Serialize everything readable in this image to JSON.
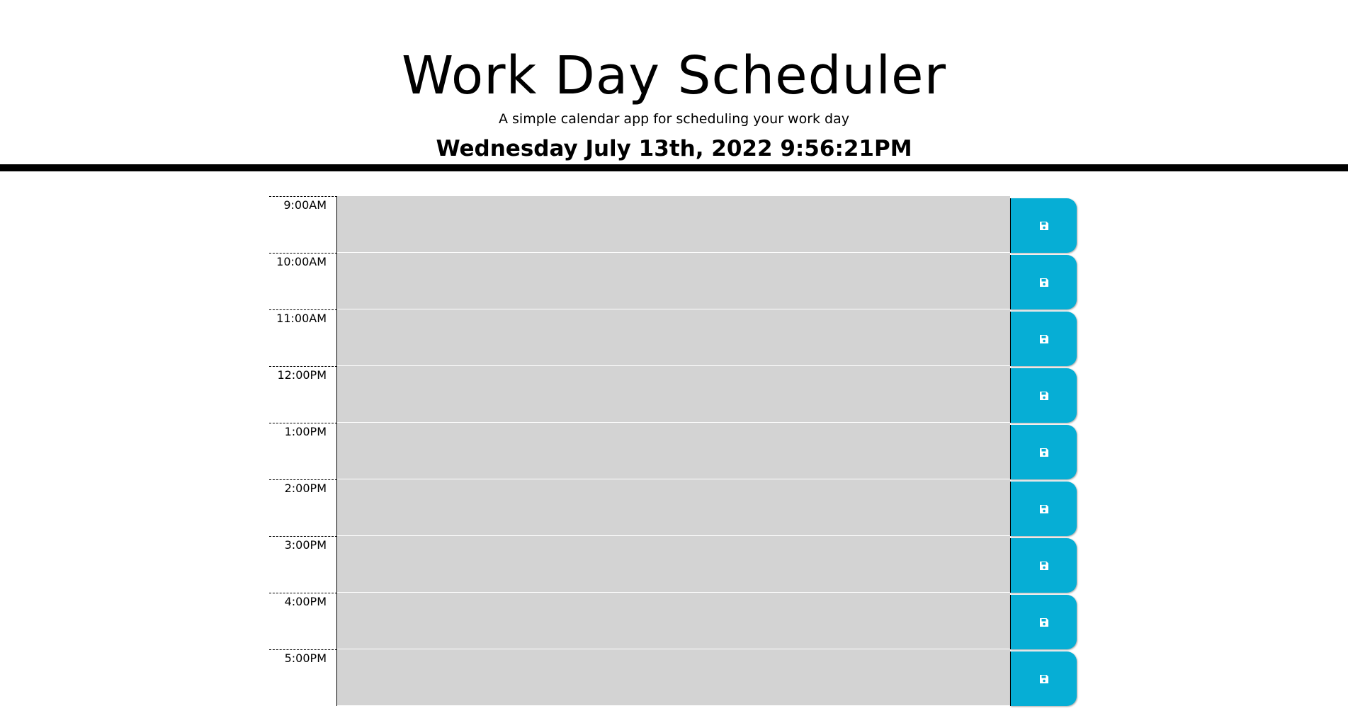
{
  "header": {
    "title": "Work Day Scheduler",
    "subtitle": "A simple calendar app for scheduling your work day",
    "current_day": "Wednesday July 13th, 2022 9:56:21PM"
  },
  "schedule": {
    "rows": [
      {
        "hour": "9:00AM",
        "description": "",
        "status": "past",
        "icon": "floppy-disk-icon"
      },
      {
        "hour": "10:00AM",
        "description": "",
        "status": "past",
        "icon": "floppy-disk-icon"
      },
      {
        "hour": "11:00AM",
        "description": "",
        "status": "past",
        "icon": "floppy-disk-icon"
      },
      {
        "hour": "12:00PM",
        "description": "",
        "status": "past",
        "icon": "floppy-disk-icon"
      },
      {
        "hour": "1:00PM",
        "description": "",
        "status": "past",
        "icon": "floppy-disk-icon"
      },
      {
        "hour": "2:00PM",
        "description": "",
        "status": "past",
        "icon": "floppy-disk-icon"
      },
      {
        "hour": "3:00PM",
        "description": "",
        "status": "past",
        "icon": "floppy-disk-icon"
      },
      {
        "hour": "4:00PM",
        "description": "",
        "status": "past",
        "icon": "floppy-disk-icon"
      },
      {
        "hour": "5:00PM",
        "description": "",
        "status": "past",
        "icon": "floppy-disk-icon"
      }
    ]
  },
  "colors": {
    "past": "#d3d3d3",
    "save_button": "#06aed5",
    "header_rule": "#000000"
  }
}
